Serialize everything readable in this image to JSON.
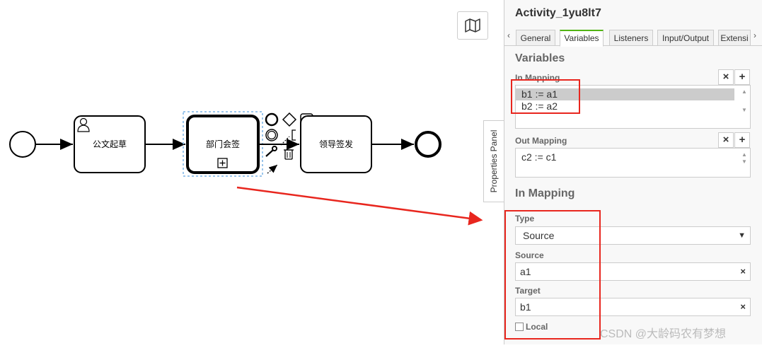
{
  "diagram": {
    "tasks": [
      {
        "label": "公文起草"
      },
      {
        "label": "部门会签"
      },
      {
        "label": "领导签发"
      }
    ]
  },
  "panel": {
    "toggle_label": "Properties Panel",
    "element_id": "Activity_1yu8lt7",
    "tabs": [
      {
        "label": "General"
      },
      {
        "label": "Variables"
      },
      {
        "label": "Listeners"
      },
      {
        "label": "Input/Output"
      },
      {
        "label": "Extensi"
      }
    ],
    "variables": {
      "group_title": "Variables",
      "in_mapping_label": "In Mapping",
      "in_mapping_items": [
        "b1 := a1",
        "b2 := a2"
      ],
      "out_mapping_label": "Out Mapping",
      "out_mapping_items": [
        "c2 := c1"
      ]
    },
    "detail": {
      "group_title": "In Mapping",
      "type_label": "Type",
      "type_value": "Source",
      "source_label": "Source",
      "source_value": "a1",
      "target_label": "Target",
      "target_value": "b1",
      "local_label": "Local"
    }
  },
  "watermark": "CSDN @大龄码农有梦想",
  "colors": {
    "accent_tab": "#52b415",
    "annotation_red": "#e8261e"
  }
}
